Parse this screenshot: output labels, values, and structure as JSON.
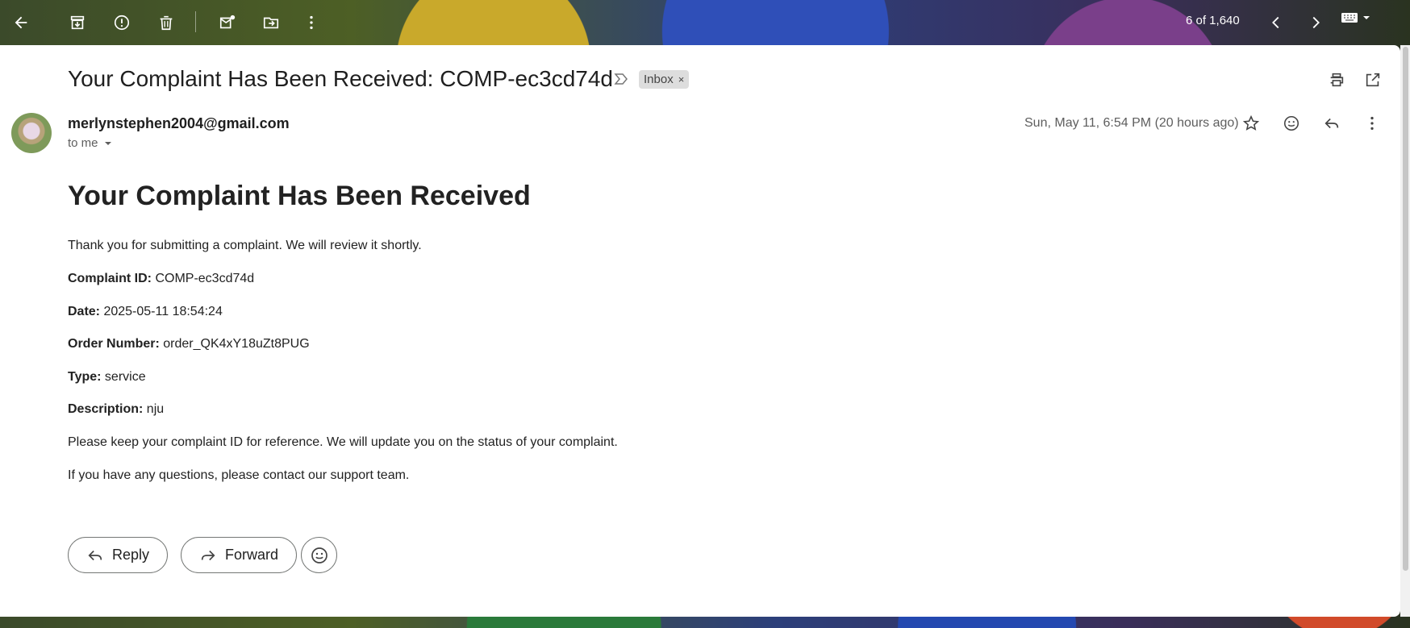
{
  "toolbar": {
    "icons": [
      "back-arrow-icon",
      "archive-icon",
      "report-spam-icon",
      "delete-icon",
      "mark-unread-icon",
      "move-to-icon",
      "more-vert-icon"
    ],
    "pager_text": "6 of 1,640",
    "keyboard_icon": "keyboard-icon"
  },
  "email": {
    "subject": "Your Complaint Has Been Received: COMP-ec3cd74d",
    "label": "Inbox",
    "label_remove": "×",
    "sender": "merlynstephen2004@gmail.com",
    "recipient": "to me",
    "date": "Sun, May 11, 6:54 PM (20 hours ago)",
    "heading": "Your Complaint Has Been Received",
    "intro": "Thank you for submitting a complaint. We will review it shortly.",
    "fields": [
      {
        "label": "Complaint ID:",
        "value": " COMP-ec3cd74d"
      },
      {
        "label": "Date:",
        "value": " 2025-05-11 18:54:24"
      },
      {
        "label": "Order Number:",
        "value": " order_QK4xY18uZt8PUG"
      },
      {
        "label": "Type:",
        "value": " service"
      },
      {
        "label": "Description:",
        "value": " nju"
      }
    ],
    "outro1": "Please keep your complaint ID for reference. We will update you on the status of your complaint.",
    "outro2": "If you have any questions, please contact our support team."
  },
  "actions": {
    "reply": "Reply",
    "forward": "Forward"
  }
}
